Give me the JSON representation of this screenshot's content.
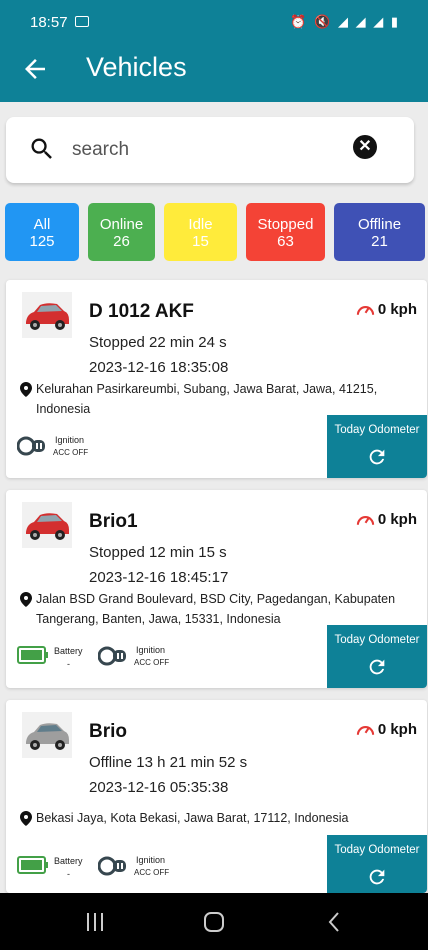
{
  "status_bar": {
    "time": "18:57"
  },
  "app_bar": {
    "title": "Vehicles"
  },
  "search": {
    "placeholder": "search"
  },
  "filters": [
    {
      "label": "All",
      "count": "125",
      "color": "#2196f3"
    },
    {
      "label": "Online",
      "count": "26",
      "color": "#4caf50"
    },
    {
      "label": "Idle",
      "count": "15",
      "color": "#ffeb3b"
    },
    {
      "label": "Stopped",
      "count": "63",
      "color": "#f44336"
    },
    {
      "label": "Offline",
      "count": "21",
      "color": "#3f51b5"
    }
  ],
  "vehicles": [
    {
      "name": "D 1012 AKF",
      "speed": "0 kph",
      "status": "Stopped 22 min 24 s",
      "timestamp": "2023-12-16 18:35:08",
      "address": "Kelurahan Pasirkareumbi, Subang, Jawa Barat, Jawa, 41215, Indonesia",
      "car_color": "red",
      "ignition_label": "Ignition",
      "ignition_value": "ACC OFF",
      "odometer_label": "Today Odometer"
    },
    {
      "name": "Brio1",
      "speed": "0 kph",
      "status": "Stopped 12 min 15 s",
      "timestamp": "2023-12-16 18:45:17",
      "address": "Jalan BSD Grand Boulevard, BSD City, Pagedangan, Kabupaten Tangerang, Banten, Jawa, 15331, Indonesia",
      "car_color": "red",
      "battery_label": "Battery",
      "battery_value": "-",
      "ignition_label": "Ignition",
      "ignition_value": "ACC OFF",
      "odometer_label": "Today Odometer"
    },
    {
      "name": "Brio",
      "speed": "0 kph",
      "status": "Offline 13 h 21 min 52 s",
      "timestamp": "2023-12-16 05:35:38",
      "address": "Bekasi Jaya, Kota Bekasi, Jawa Barat, 17112, Indonesia",
      "car_color": "gray",
      "battery_label": "Battery",
      "battery_value": "-",
      "ignition_label": "Ignition",
      "ignition_value": "ACC OFF",
      "odometer_label": "Today Odometer"
    }
  ],
  "colors": {
    "primary": "#0e8197",
    "speed_icon": "#e53935",
    "battery": "#43a047"
  }
}
